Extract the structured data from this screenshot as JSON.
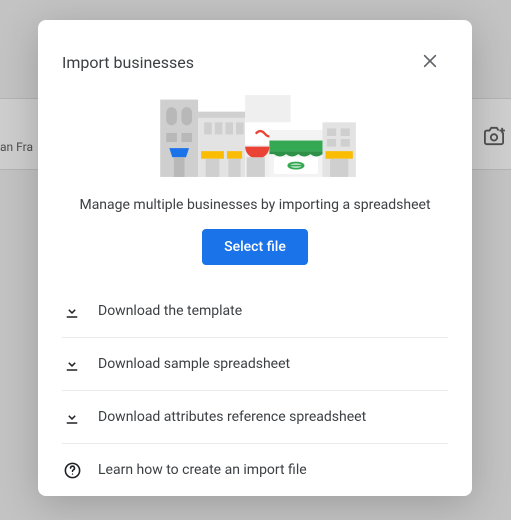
{
  "background": {
    "partial_text": "an Fra"
  },
  "dialog": {
    "title": "Import businesses",
    "subtitle": "Manage multiple businesses by importing a spreadsheet",
    "select_button": "Select file",
    "links": [
      {
        "icon": "download",
        "label": "Download the template"
      },
      {
        "icon": "download",
        "label": "Download sample spreadsheet"
      },
      {
        "icon": "download",
        "label": "Download attributes reference spreadsheet"
      },
      {
        "icon": "help",
        "label": "Learn how to create an import file"
      }
    ]
  }
}
